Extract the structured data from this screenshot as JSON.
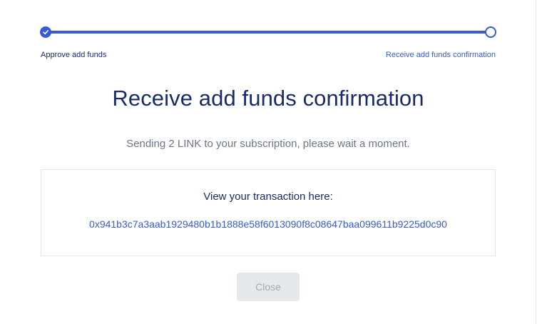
{
  "stepper": {
    "steps": [
      {
        "label": "Approve add funds",
        "status": "complete"
      },
      {
        "label": "Receive add funds confirmation",
        "status": "current"
      }
    ],
    "accent_color": "#375bd2"
  },
  "main": {
    "title": "Receive add funds confirmation",
    "subtitle": "Sending 2 LINK to your subscription, please wait a moment.",
    "transaction": {
      "label": "View your transaction here:",
      "hash": "0x941b3c7a3aab1929480b1b1888e58f6013090f8c08647baa099611b9225d0c90"
    },
    "close_label": "Close"
  },
  "colors": {
    "heading": "#1a2b6b",
    "link": "#375bd2",
    "muted_text": "#6c7585",
    "disabled_button_bg": "#e6e8ec"
  }
}
